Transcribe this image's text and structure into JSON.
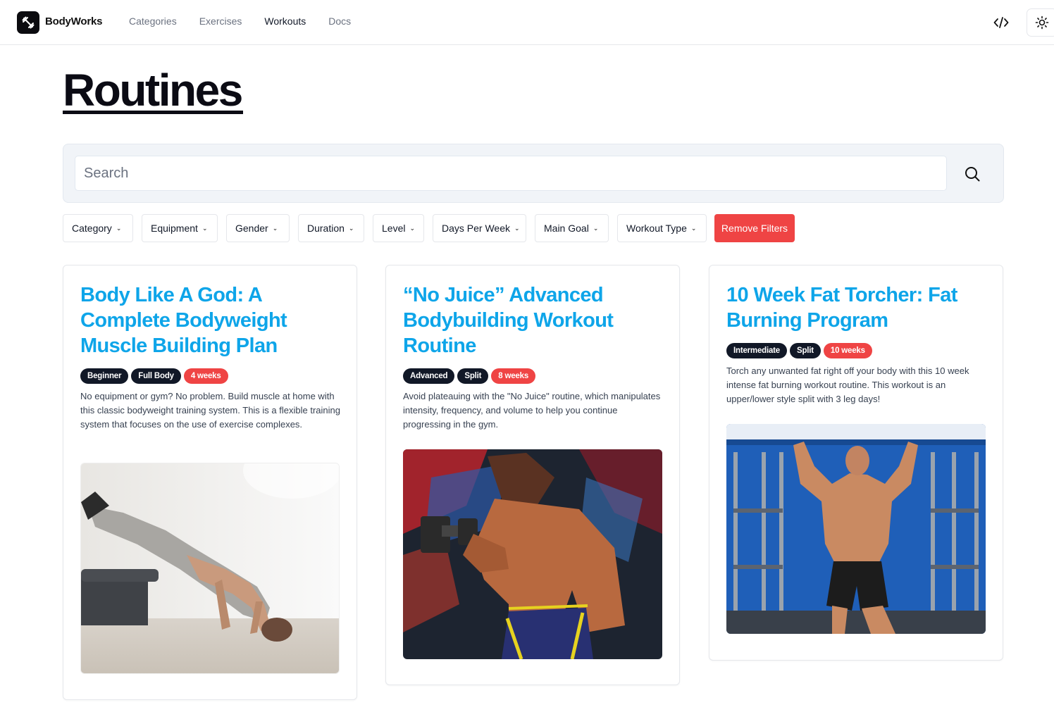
{
  "brand": {
    "name": "BodyWorks",
    "logo_icon": "dumbbell-icon"
  },
  "nav": {
    "items": [
      {
        "label": "Categories",
        "active": false
      },
      {
        "label": "Exercises",
        "active": false
      },
      {
        "label": "Workouts",
        "active": true
      },
      {
        "label": "Docs",
        "active": false
      }
    ]
  },
  "header_actions": {
    "code_icon": "code-icon",
    "theme_icon": "sun-icon"
  },
  "page": {
    "title": "Routines"
  },
  "search": {
    "placeholder": "Search",
    "value": "",
    "icon": "search-icon"
  },
  "filters": {
    "items": [
      "Category",
      "Equipment",
      "Gender",
      "Duration",
      "Level",
      "Days Per Week",
      "Main Goal",
      "Workout Type"
    ],
    "remove_label": "Remove Filters"
  },
  "colors": {
    "accent": "#0ea5e9",
    "danger": "#ef4444",
    "dark": "#111827"
  },
  "cards": [
    {
      "title": "Body Like A God: A Complete Bodyweight Muscle Building Plan",
      "badges": [
        "Beginner",
        "Full Body",
        "4 weeks"
      ],
      "description": "No equipment or gym? No problem. Build muscle at home with this classic bodyweight training system. This is a flexible training system that focuses on the use of exercise complexes."
    },
    {
      "title": "“No Juice” Advanced Bodybuilding Workout Routine",
      "badges": [
        "Advanced",
        "Split",
        "8 weeks"
      ],
      "description": "Avoid plateauing with the \"No Juice\" routine, which manipulates intensity, frequency, and volume to help you continue progressing in the gym."
    },
    {
      "title": "10 Week Fat Torcher: Fat Burning Program",
      "badges": [
        "Intermediate",
        "Split",
        "10 weeks"
      ],
      "description": "Torch any unwanted fat right off your body with this 10 week intense fat burning workout routine. This workout is an upper/lower style split with 3 leg days!"
    }
  ]
}
